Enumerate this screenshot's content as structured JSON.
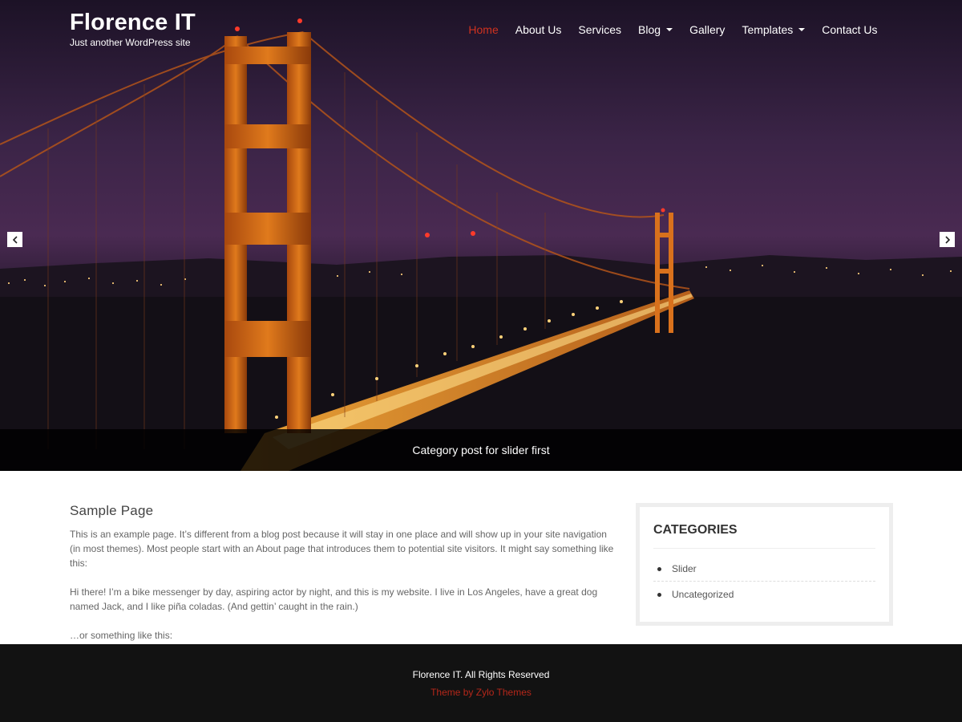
{
  "site": {
    "title": "Florence IT",
    "tagline": "Just another WordPress site"
  },
  "nav": {
    "items": [
      {
        "label": "Home",
        "active": true,
        "has_dropdown": false
      },
      {
        "label": "About Us",
        "active": false,
        "has_dropdown": false
      },
      {
        "label": "Services",
        "active": false,
        "has_dropdown": false
      },
      {
        "label": "Blog",
        "active": false,
        "has_dropdown": true
      },
      {
        "label": "Gallery",
        "active": false,
        "has_dropdown": false
      },
      {
        "label": "Templates",
        "active": false,
        "has_dropdown": true
      },
      {
        "label": "Contact Us",
        "active": false,
        "has_dropdown": false
      }
    ]
  },
  "slider": {
    "caption": "Category post for slider first",
    "prev_icon": "chevron-left-icon",
    "next_icon": "chevron-right-icon"
  },
  "page": {
    "title": "Sample Page",
    "paragraphs": [
      "This is an example page. It’s different from a blog post because it will stay in one place and will show up in your site navigation (in most themes). Most people start with an About page that introduces them to potential site visitors. It might say something like this:",
      "Hi there! I’m a bike messenger by day, aspiring actor by night, and this is my website. I live in Los Angeles, have a great dog named Jack, and I like piña coladas. (And gettin’ caught in the rain.)",
      "…or something like this:"
    ]
  },
  "sidebar": {
    "title": "CATEGORIES",
    "categories": [
      "Slider",
      "Uncategorized"
    ]
  },
  "footer": {
    "copyright": "Florence IT. All Rights Reserved",
    "theme_credit": "Theme by Zylo Themes"
  },
  "colors": {
    "accent": "#d0321f",
    "footer_bg": "#121212",
    "caption_bg": "#000000"
  }
}
